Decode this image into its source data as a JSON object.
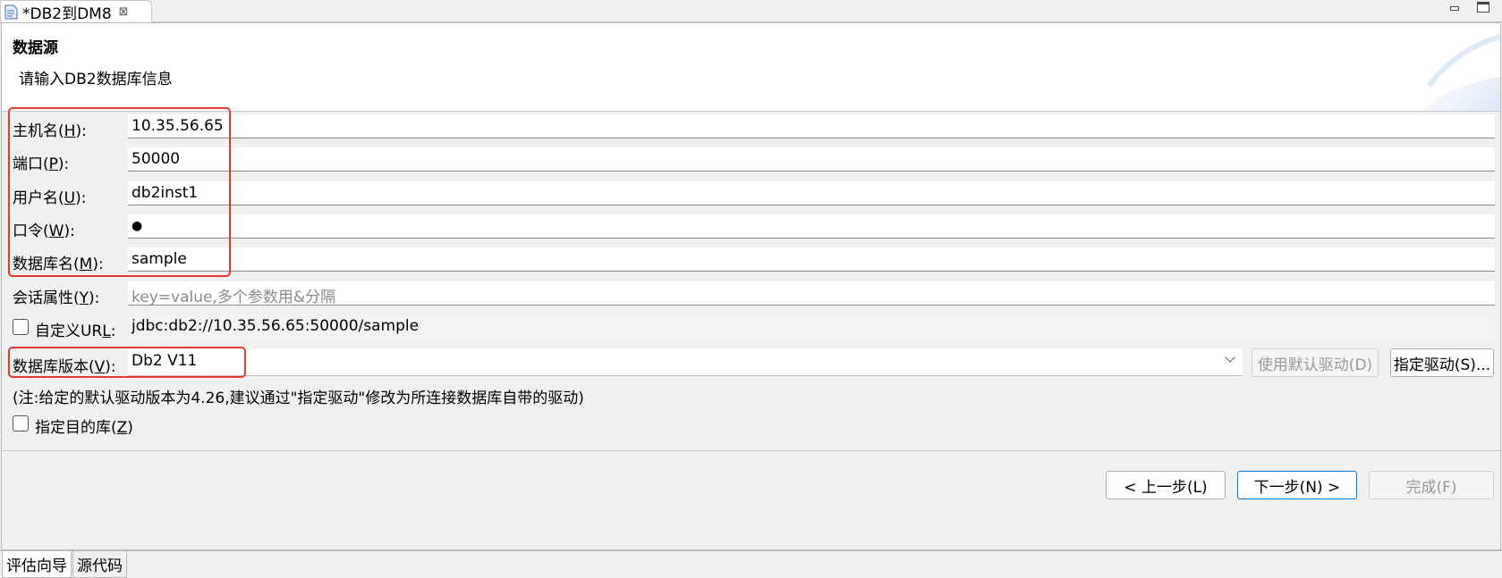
{
  "editor_tab": {
    "title": "*DB2到DM8",
    "close": "⊠"
  },
  "header": {
    "title": "数据源",
    "description": "请输入DB2数据库信息"
  },
  "form": {
    "host": {
      "label": "主机名(",
      "mnemonic": "H",
      "suffix": "):",
      "value": "10.35.56.65"
    },
    "port": {
      "label": "端口(",
      "mnemonic": "P",
      "suffix": "):",
      "value": "50000"
    },
    "user": {
      "label": "用户名(",
      "mnemonic": "U",
      "suffix": "):",
      "value": "db2inst1"
    },
    "password": {
      "label": "口令(",
      "mnemonic": "W",
      "suffix": "):",
      "value": "●"
    },
    "database": {
      "label": "数据库名(",
      "mnemonic": "M",
      "suffix": "):",
      "value": "sample"
    },
    "session": {
      "label": "会话属性(",
      "mnemonic": "Y",
      "suffix": "):",
      "placeholder": "key=value,多个参数用&分隔"
    },
    "custom_url": {
      "label": "自定义UR",
      "mnemonic": "L",
      "suffix": ":",
      "value": "jdbc:db2://10.35.56.65:50000/sample",
      "checked": false
    },
    "db_version": {
      "label": "数据库版本(",
      "mnemonic": "V",
      "suffix": "):",
      "value": "Db2 V11"
    },
    "default_driver_button": "使用默认驱动(D)",
    "specify_driver_button": "指定驱动(S)...",
    "note": "(注:给定的默认驱动版本为4.26,建议通过\"指定驱动\"修改为所连接数据库自带的驱动)",
    "target_db": {
      "label": "指定目的库(",
      "mnemonic": "Z",
      "suffix": ")",
      "checked": false
    }
  },
  "buttons": {
    "back": "< 上一步(L)",
    "next": "下一步(N) >",
    "finish": "完成(F)"
  },
  "bottom_tabs": [
    "评估向导",
    "源代码"
  ],
  "colors": {
    "highlight_box": "#e53935",
    "accent": "#0078d7"
  }
}
